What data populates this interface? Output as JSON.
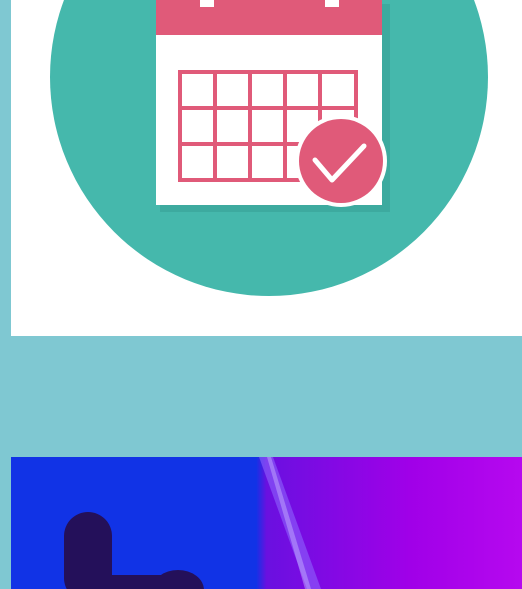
{
  "cards": [
    {
      "name": "calendar-check-card",
      "icon": "calendar-check-icon",
      "colors": {
        "background": "#ffffff",
        "circle": "#45b8ac",
        "calendar_header": "#e05a79",
        "grid": "#e05a79",
        "check_badge": "#e05a79",
        "check_mark": "#ffffff"
      }
    },
    {
      "name": "gradient-promo-card",
      "icon": "pointing-hand-icon",
      "colors": {
        "left_panel": "#1133e6",
        "right_panel_start": "#6a10e0",
        "right_panel_end": "#b608ef",
        "hand": "#24105a"
      }
    }
  ],
  "page": {
    "background": "#7fc8d2"
  }
}
